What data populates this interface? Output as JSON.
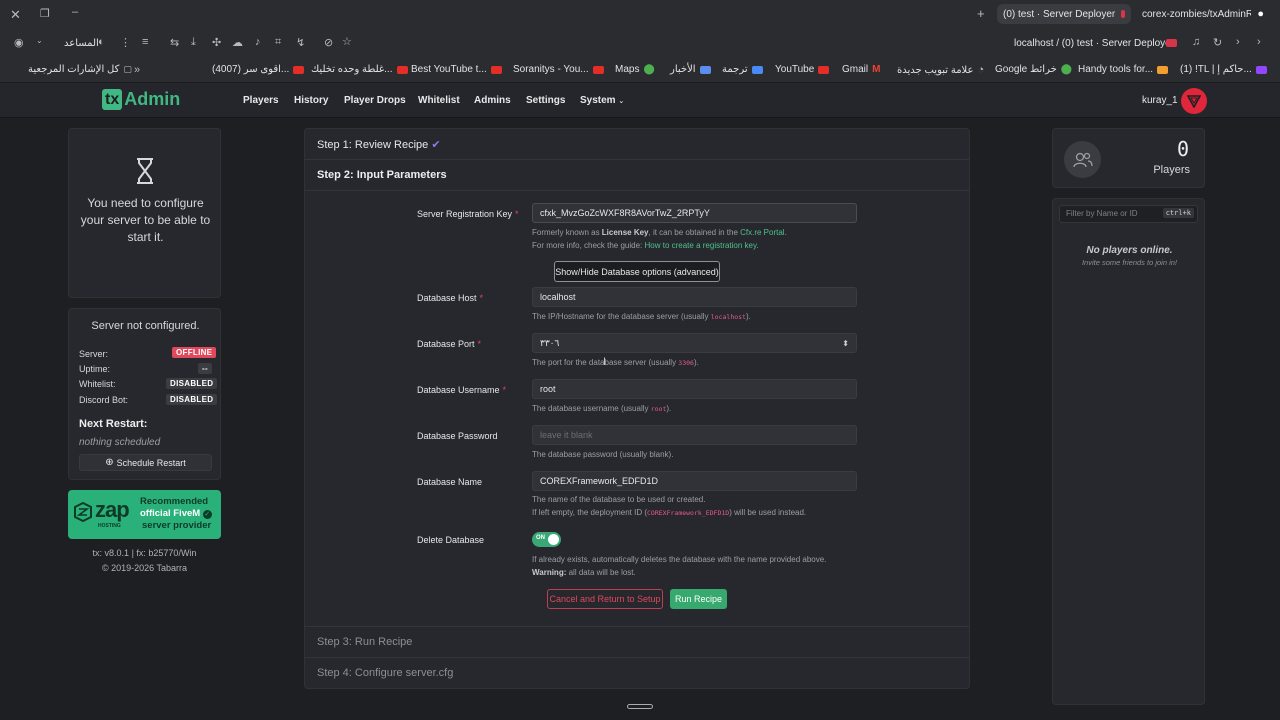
{
  "browser": {
    "tabs": [
      {
        "title": "(0) test · Server Deployer",
        "active": true
      },
      {
        "title": "corex-zombies/txAdminR..."
      }
    ],
    "assistant_label": "المساعد",
    "address": "localhost / (0) test · Server Deployer",
    "bookmarks": [
      {
        "label": "كل الإشارات المرجعية"
      },
      {
        "label": "(4007) اقوى سر..."
      },
      {
        "label": "غلطة وحده تخليك..."
      },
      {
        "label": "Best YouTube t..."
      },
      {
        "label": "Soranitys - You..."
      },
      {
        "label": "Maps"
      },
      {
        "label": "الأخبار"
      },
      {
        "label": "ترجمة"
      },
      {
        "label": "YouTube"
      },
      {
        "label": "Gmail"
      },
      {
        "label": "علامة تبويب جديدة"
      },
      {
        "label": "Google خرائط"
      },
      {
        "label": "Handy tools for..."
      },
      {
        "label": "(1) !TL | حاكم إ..."
      }
    ]
  },
  "app": {
    "logo_tx": "tx",
    "logo_admin": "Admin",
    "nav": [
      "Players",
      "History",
      "Player Drops",
      "Whitelist",
      "Admins",
      "Settings",
      "System"
    ],
    "user": "kuray_1"
  },
  "left": {
    "config_message": "You need to configure your server to be able to start it.",
    "status_title": "Server not configured.",
    "rows": [
      {
        "label": "Server:",
        "value": "OFFLINE"
      },
      {
        "label": "Uptime:",
        "value": "--"
      },
      {
        "label": "Whitelist:",
        "value": "DISABLED"
      },
      {
        "label": "Discord Bot:",
        "value": "DISABLED"
      }
    ],
    "next_restart_title": "Next Restart:",
    "next_restart_value": "nothing scheduled",
    "schedule_button": "Schedule Restart",
    "zap_logo": "zap",
    "zap_sub": "HOSTING",
    "zap_line1": "Recommended",
    "zap_line2": "official FiveM",
    "zap_line3": "server provider",
    "version": "tx: v8.0.1 | fx: b25770/Win",
    "copyright": "© 2019-2026 Tabarra"
  },
  "deployer": {
    "step1": "Step 1: Review Recipe",
    "step2": "Step 2: Input Parameters",
    "step3": "Step 3: Run Recipe",
    "step4": "Step 4: Configure server.cfg",
    "fields": {
      "reg_key": {
        "label": "Server Registration Key",
        "value": "cfxk_MvzGoZcWXF8R8AVorTwZ_2RPTyY",
        "help1_a": "Formerly known as ",
        "help1_b": "License Key",
        "help1_c": ", it can be obtained in the ",
        "help1_link": "Cfx.re Portal",
        "help1_d": ".",
        "help2_a": "For more info, check the guide: ",
        "help2_link": "How to create a registration key",
        "help2_b": "."
      },
      "toggle_button": "Show/Hide Database options (advanced)",
      "db_host": {
        "label": "Database Host",
        "value": "localhost",
        "help_a": "The IP/Hostname for the database server (usually ",
        "help_code": "localhost",
        "help_b": ")."
      },
      "db_port": {
        "label": "Database Port",
        "value": "٣٣٠٦",
        "help_a": "The port for the database server (usually ",
        "help_code": "3306",
        "help_b": ")."
      },
      "db_user": {
        "label": "Database Username",
        "value": "root",
        "help_a": "The database username (usually ",
        "help_code": "root",
        "help_b": ")."
      },
      "db_pass": {
        "label": "Database Password",
        "placeholder": "leave it blank",
        "help": "The database password (usually blank)."
      },
      "db_name": {
        "label": "Database Name",
        "value": "COREXFramework_EDFD1D",
        "help1": "The name of the database to be used or created.",
        "help2_a": "If left empty, the deployment ID (",
        "help2_code": "COREXFramework_EDFD1D",
        "help2_b": ") will be used instead."
      },
      "delete_db": {
        "label": "Delete Database",
        "toggle": "ON",
        "help1": "If already exists, automatically deletes the database with the name provided above.",
        "help2_b": "Warning:",
        "help2": " all data will be lost."
      }
    },
    "cancel_button": "Cancel and Return to Setup",
    "run_button": "Run Recipe"
  },
  "right": {
    "player_count": "0",
    "players_label": "Players",
    "filter_placeholder": "Filter by Name or ID",
    "filter_shortcut": "ctrl+k",
    "no_players": "No players online.",
    "invite": "Invite some friends to join in!"
  },
  "colors": {
    "accent_green": "#41b883",
    "danger": "#e0485b",
    "background": "#1e1f22",
    "card": "#26282d"
  }
}
